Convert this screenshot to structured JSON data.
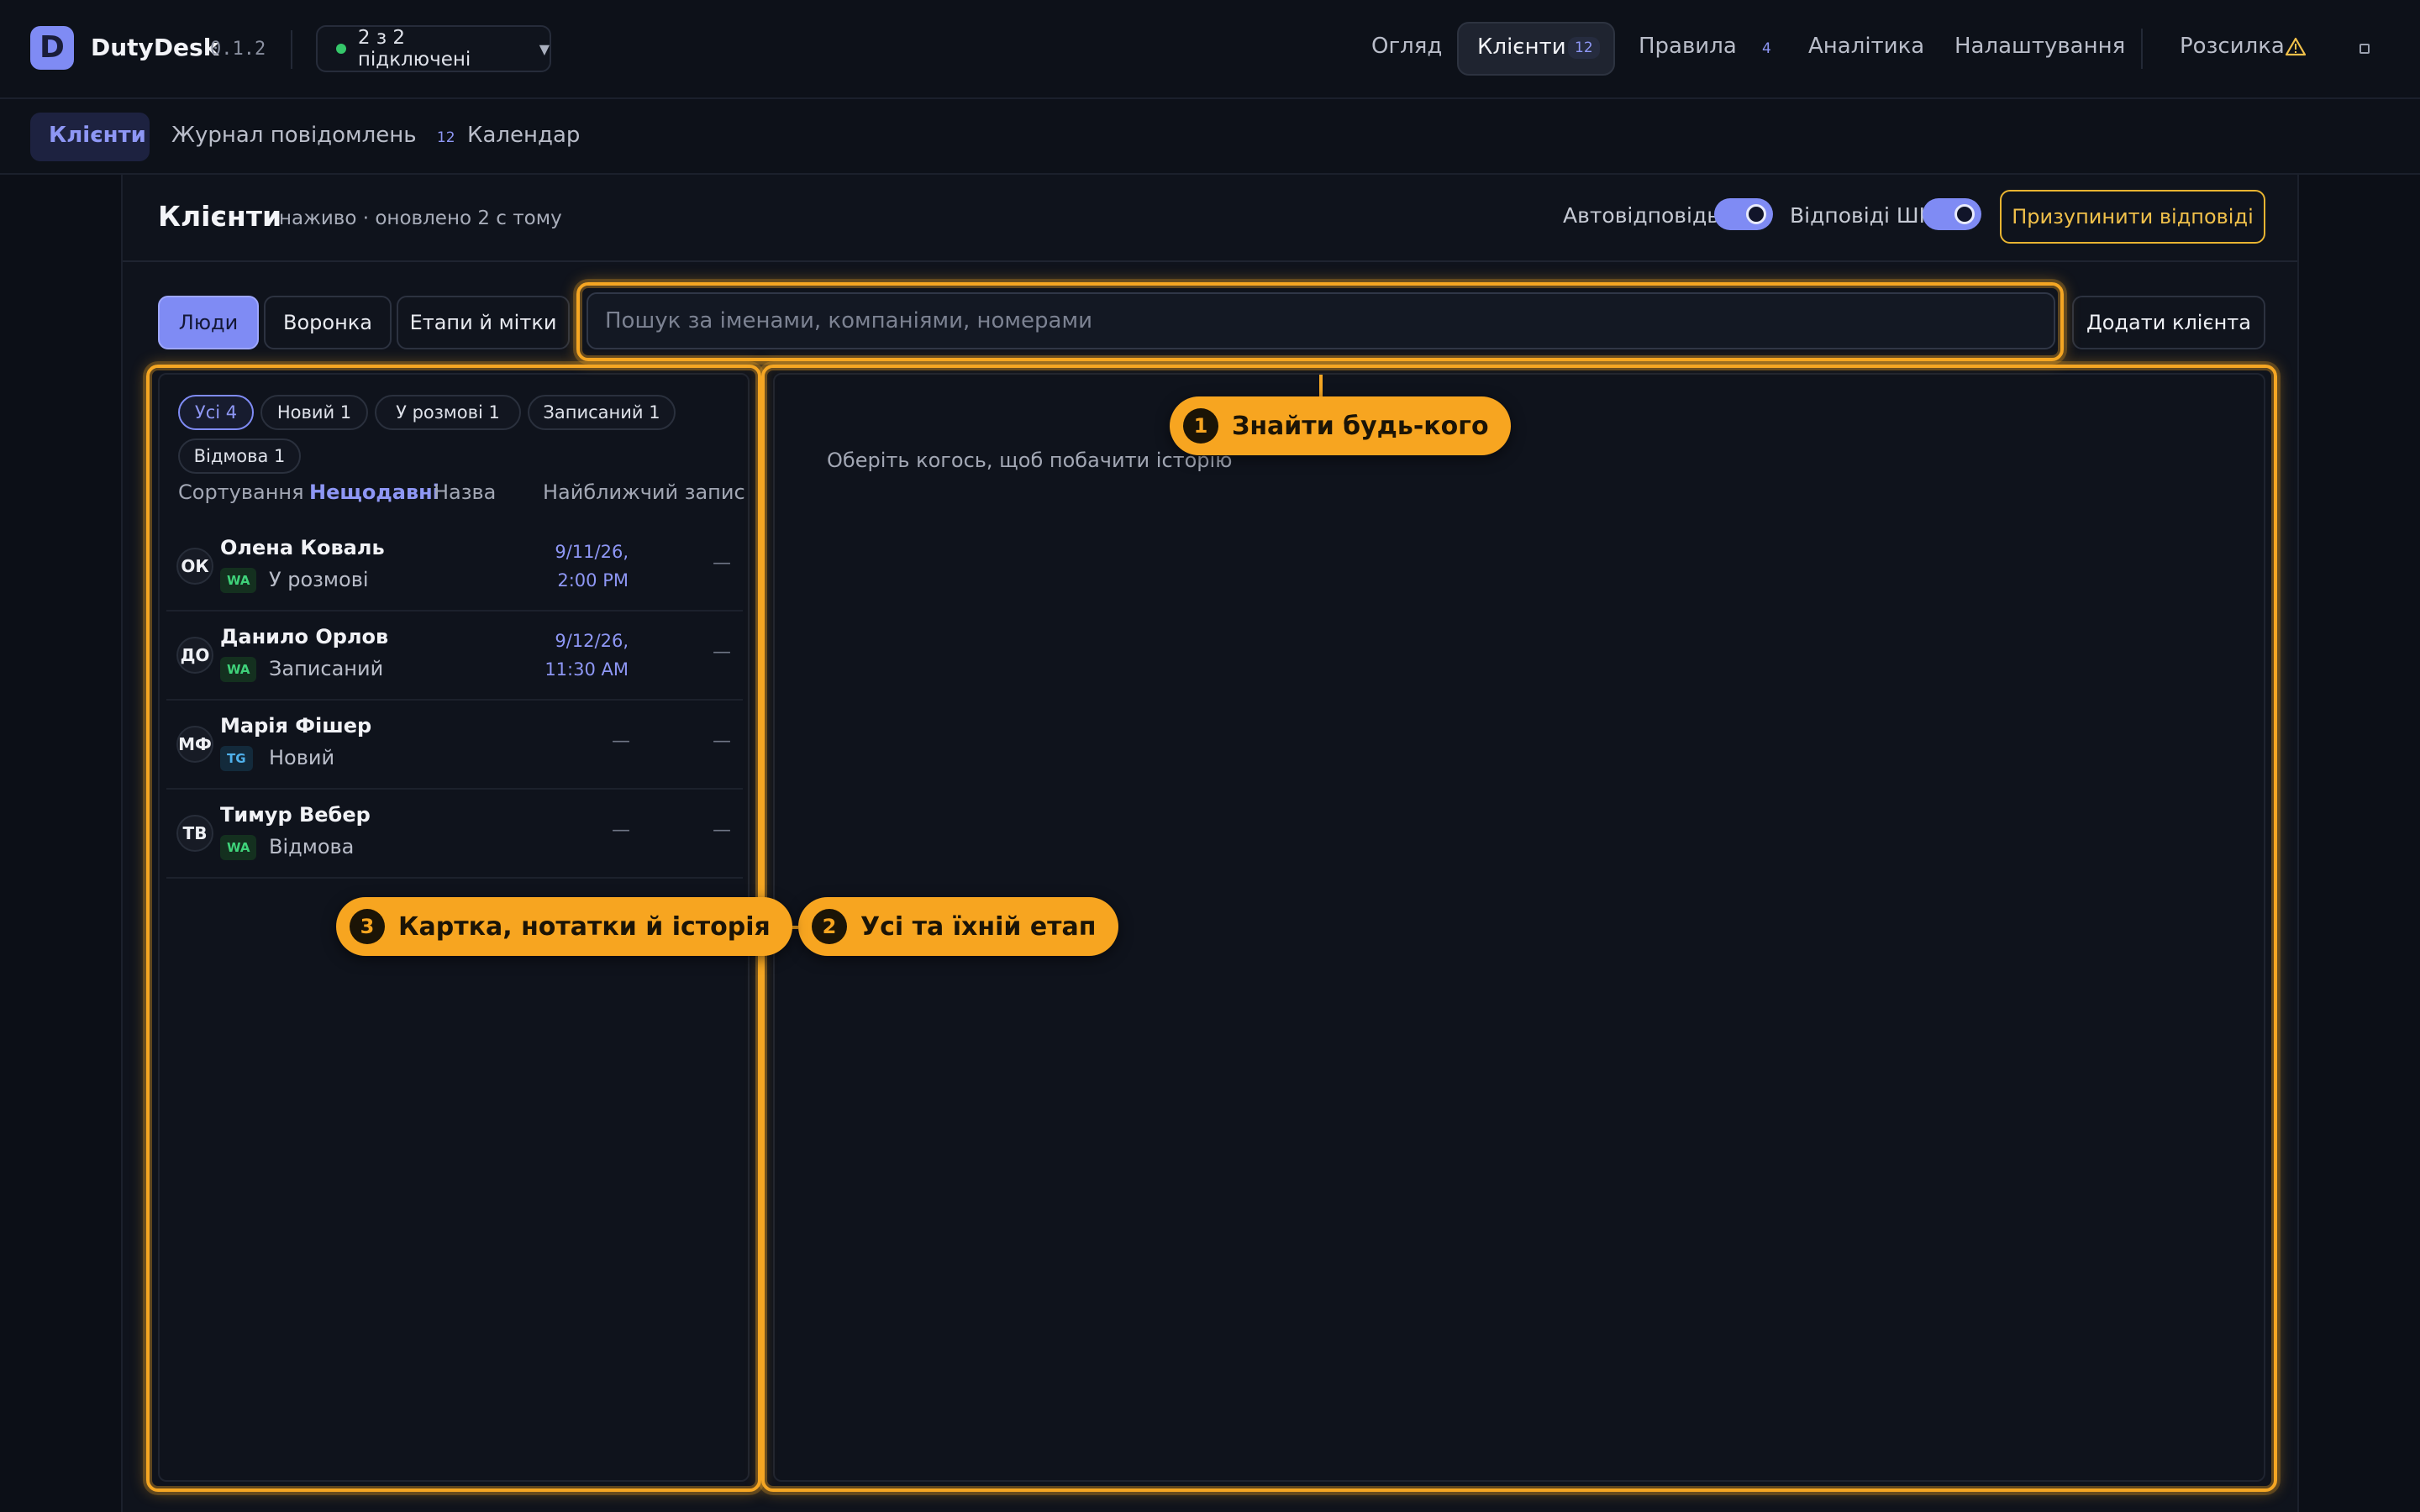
{
  "app": {
    "name": "DutyDesk",
    "version": "0.1.2"
  },
  "connection": {
    "label": "2 з 2 підключені",
    "status_color": "#35c76a"
  },
  "nav": {
    "items": [
      {
        "label": "Огляд"
      },
      {
        "label": "Клієнти",
        "badge": "12",
        "active": true
      },
      {
        "label": "Правила",
        "badge": "4"
      },
      {
        "label": "Аналітика"
      },
      {
        "label": "Налаштування"
      },
      {
        "label": "Розсилка",
        "icon": "warning-icon"
      }
    ]
  },
  "subtabs": [
    {
      "label": "Клієнти",
      "active": true
    },
    {
      "label": "Журнал повідомлень",
      "badge": "12"
    },
    {
      "label": "Календар"
    }
  ],
  "page": {
    "title": "Клієнти",
    "subtitle": "наживо · оновлено 2 с тому",
    "autoreply_label": "Автовідповідь",
    "autoreply_on": true,
    "ai_label": "Відповіді ШІ",
    "ai_on": true,
    "pause_label": "Призупинити відповіді"
  },
  "toolbar": {
    "views": [
      "Люди",
      "Воронка",
      "Етапи й мітки"
    ],
    "active_view": "Люди",
    "search_placeholder": "Пошук за іменами, компаніями, номерами",
    "add_label": "Додати клієнта"
  },
  "filters": {
    "chips": [
      "Усі 4",
      "Новий 1",
      "У розмові 1",
      "Записаний 1",
      "Відмова 1"
    ],
    "active": "Усі 4",
    "sort_label": "Сортування",
    "sort_options": [
      "Нещодавні",
      "Назва",
      "Найближчий запис"
    ],
    "sort_active": "Нещодавні"
  },
  "clients": [
    {
      "initials": "ОК",
      "name": "Олена Коваль",
      "channel": "WA",
      "stage": "У розмові",
      "date_line1": "9/11/26,",
      "date_line2": "2:00 PM",
      "col2": "—"
    },
    {
      "initials": "ДО",
      "name": "Данило Орлов",
      "channel": "WA",
      "stage": "Записаний",
      "date_line1": "9/12/26,",
      "date_line2": "11:30 AM",
      "col2": "—"
    },
    {
      "initials": "МФ",
      "name": "Марія Фішер",
      "channel": "TG",
      "stage": "Новий",
      "date_line1": "—",
      "date_line2": "",
      "col2": "—"
    },
    {
      "initials": "ТВ",
      "name": "Тимур Вебер",
      "channel": "WA",
      "stage": "Відмова",
      "date_line1": "—",
      "date_line2": "",
      "col2": "—"
    }
  ],
  "detail": {
    "empty_message": "Оберіть когось, щоб побачити історію"
  },
  "tour": {
    "accent": "#f5a623",
    "steps": [
      {
        "num": "1",
        "text": "Знайти будь-кого"
      },
      {
        "num": "2",
        "text": "Усі та їхній етап"
      },
      {
        "num": "3",
        "text": "Картка, нотатки й історія"
      }
    ]
  }
}
